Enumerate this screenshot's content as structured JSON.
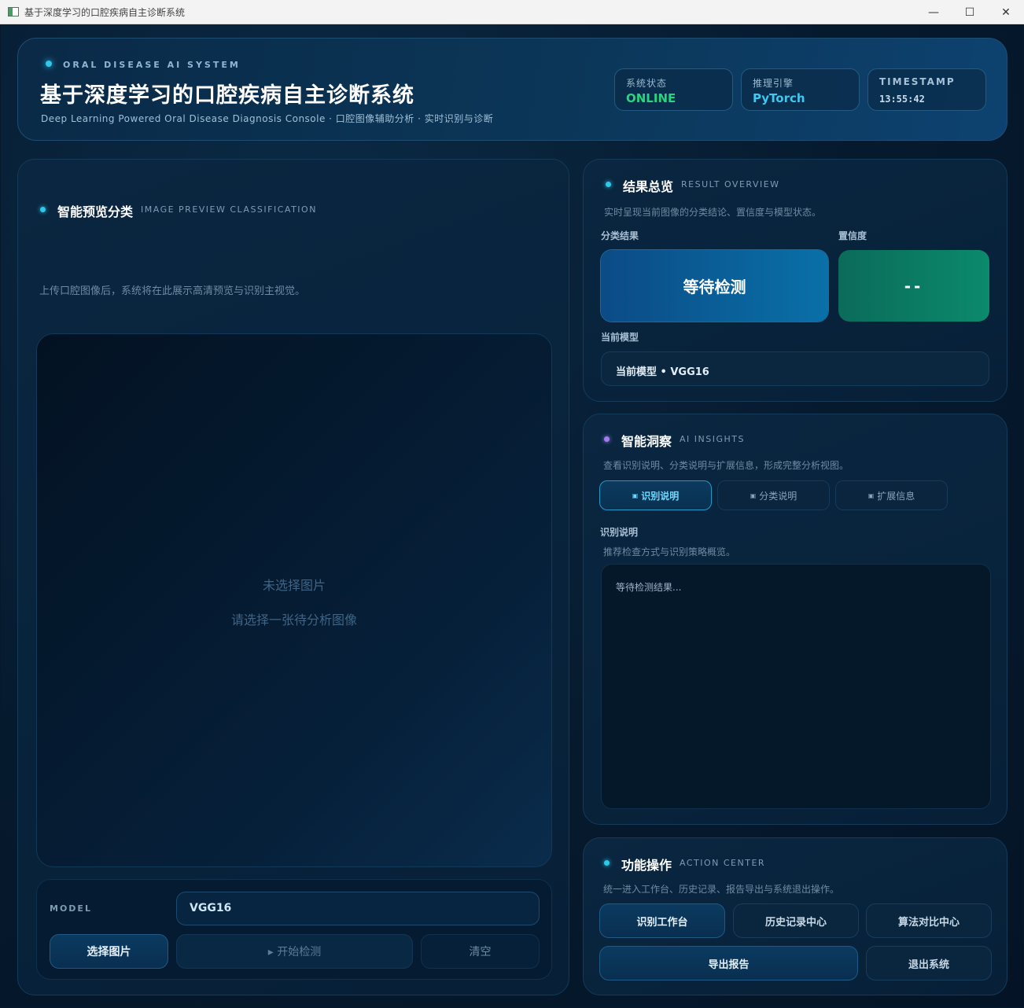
{
  "window": {
    "title": "基于深度学习的口腔疾病自主诊断系统",
    "minimize": "—",
    "maximize": "☐",
    "close": "✕"
  },
  "header": {
    "kicker": "ORAL DISEASE AI SYSTEM",
    "title": "基于深度学习的口腔疾病自主诊断系统",
    "subtitle": "Deep Learning Powered Oral Disease Diagnosis Console · 口腔图像辅助分析 · 实时识别与诊断",
    "stats": [
      {
        "label": "系统状态",
        "value": "ONLINE"
      },
      {
        "label": "推理引擎",
        "value": "PyTorch"
      },
      {
        "label": "TIMESTAMP",
        "value": "13:55:42"
      }
    ]
  },
  "preview": {
    "title": "智能预览分类",
    "title_en": "IMAGE PREVIEW CLASSIFICATION",
    "description": "上传口腔图像后，系统将在此展示高清预览与识别主视觉。",
    "placeholder_line1": "未选择图片",
    "placeholder_line2": "请选择一张待分析图像",
    "model_label": "MODEL",
    "model_value": "VGG16",
    "select_button": "选择图片",
    "start_button": "▸  开始检测",
    "clear_button": "清空"
  },
  "result": {
    "title": "结果总览",
    "title_en": "RESULT OVERVIEW",
    "description": "实时呈现当前图像的分类结论、置信度与模型状态。",
    "class_label": "分类结果",
    "confidence_label": "置信度",
    "class_value": "等待检测",
    "confidence_value": "--",
    "model_label": "当前模型",
    "model_value": "当前模型 • VGG16"
  },
  "insights": {
    "title": "智能洞察",
    "title_en": "AI INSIGHTS",
    "description": "查看识别说明、分类说明与扩展信息，形成完整分析视图。",
    "tabs": [
      {
        "icon": "▣",
        "label": "识别说明"
      },
      {
        "icon": "▣",
        "label": "分类说明"
      },
      {
        "icon": "▣",
        "label": "扩展信息"
      }
    ],
    "section_title": "识别说明",
    "section_desc": "推荐检查方式与识别策略概览。",
    "content": "等待检测结果..."
  },
  "actions": {
    "title": "功能操作",
    "title_en": "ACTION CENTER",
    "description": "统一进入工作台、历史记录、报告导出与系统退出操作。",
    "workbench": "识别工作台",
    "history": "历史记录中心",
    "compare": "算法对比中心",
    "export": "导出报告",
    "exit": "退出系统"
  }
}
